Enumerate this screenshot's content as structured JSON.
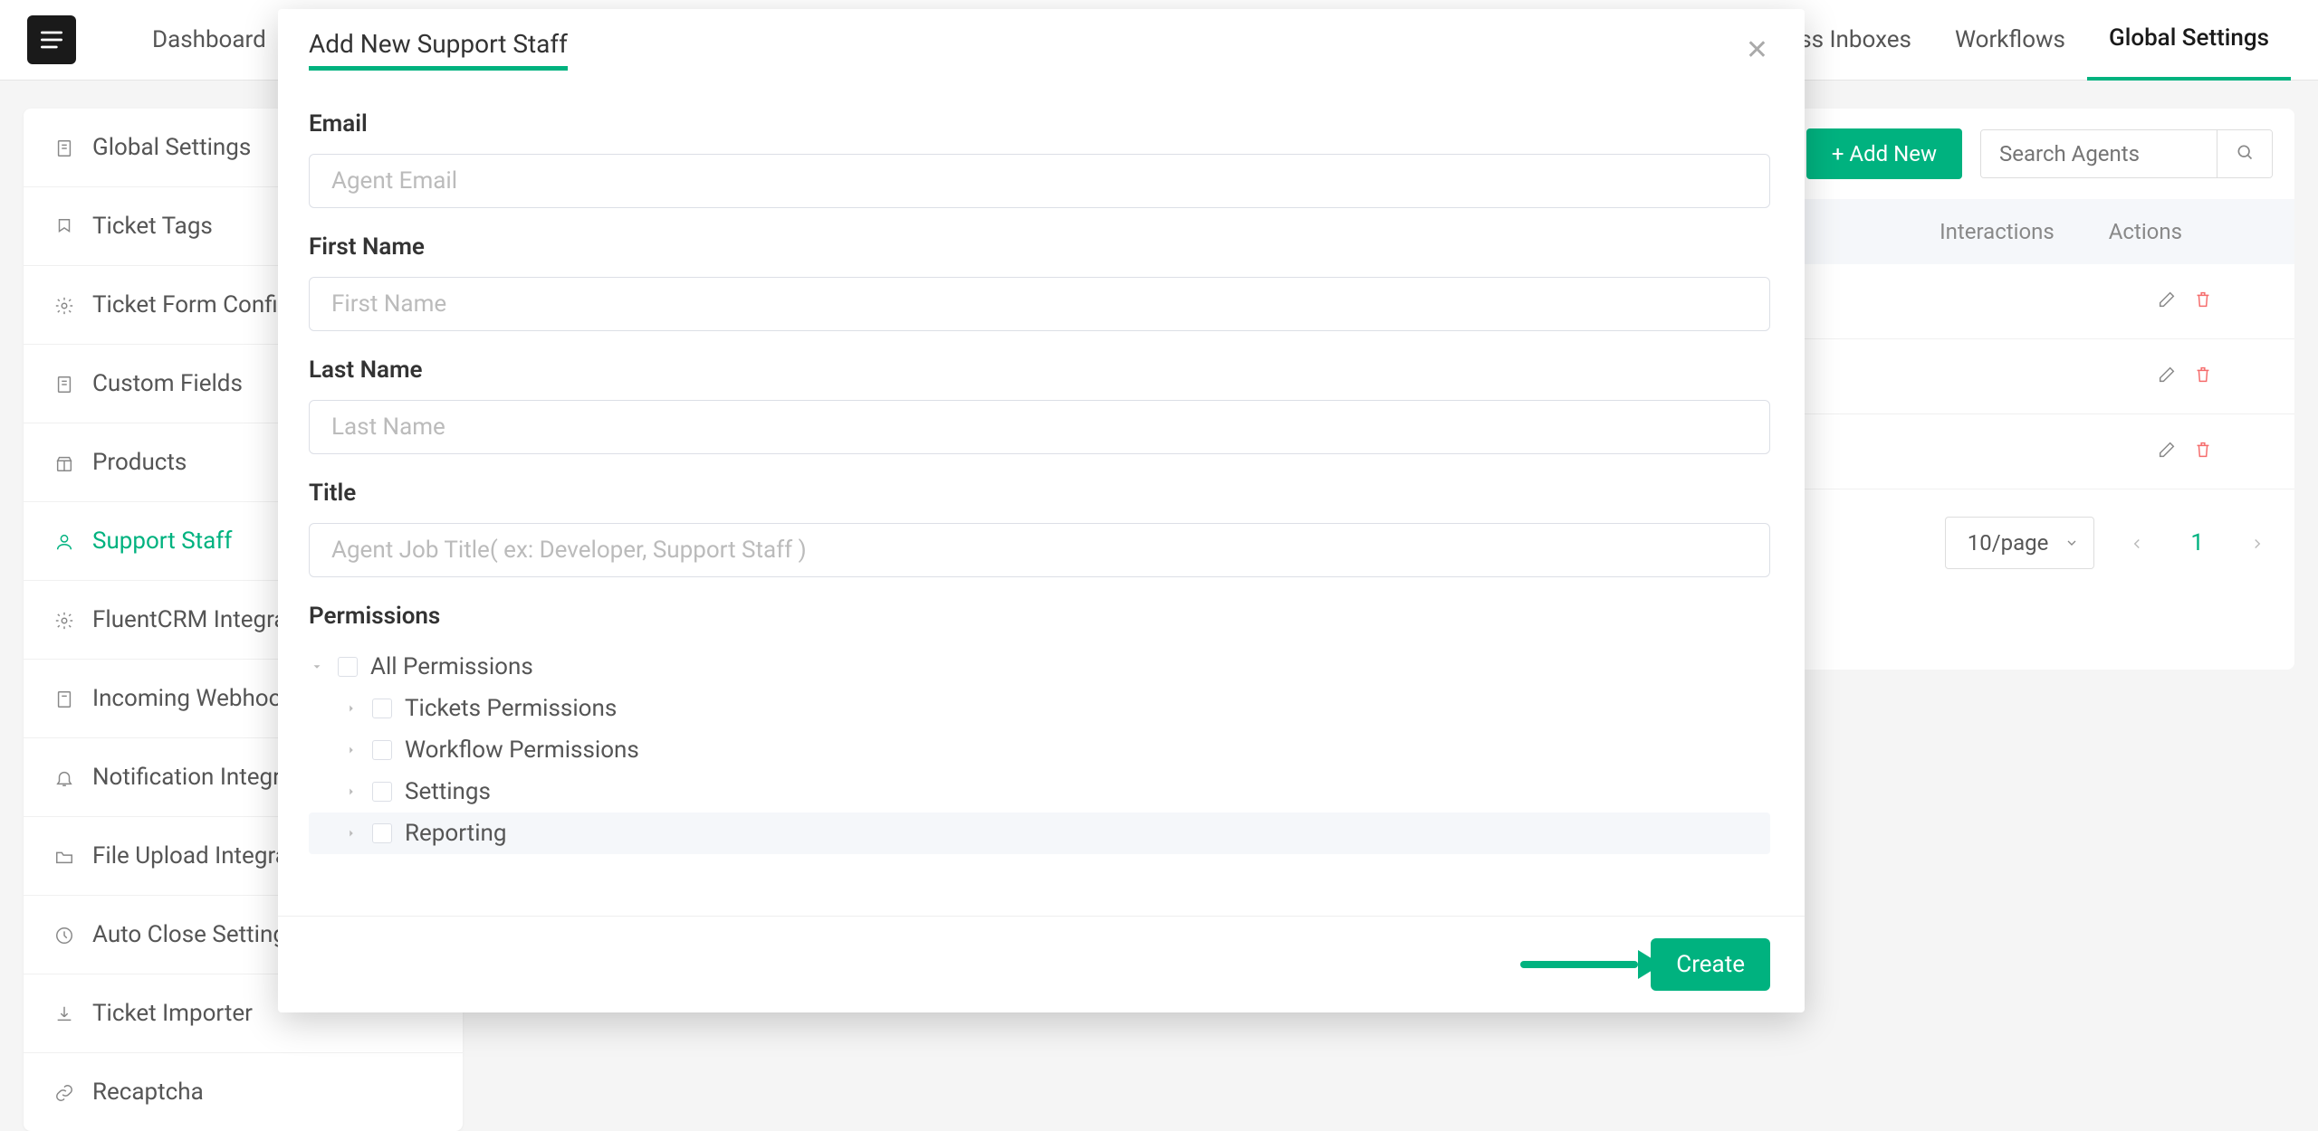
{
  "nav": {
    "dashboard": "Dashboard",
    "business_inboxes": "Business Inboxes",
    "workflows": "Workflows",
    "global_settings": "Global Settings"
  },
  "sidebar": {
    "items": [
      {
        "label": "Global Settings",
        "icon": "document-icon"
      },
      {
        "label": "Ticket Tags",
        "icon": "tag-icon"
      },
      {
        "label": "Ticket Form Config",
        "icon": "gear-icon"
      },
      {
        "label": "Custom Fields",
        "icon": "document-icon"
      },
      {
        "label": "Products",
        "icon": "gift-icon"
      },
      {
        "label": "Support Staff",
        "icon": "user-icon"
      },
      {
        "label": "FluentCRM Integration",
        "icon": "gear-icon"
      },
      {
        "label": "Incoming Webhook",
        "icon": "document-icon"
      },
      {
        "label": "Notification Integrations",
        "icon": "bell-icon"
      },
      {
        "label": "File Upload Integration",
        "icon": "folder-icon"
      },
      {
        "label": "Auto Close Settings",
        "icon": "clock-icon"
      },
      {
        "label": "Ticket Importer",
        "icon": "download-icon"
      },
      {
        "label": "Recaptcha",
        "icon": "link-icon"
      }
    ]
  },
  "toolbar": {
    "add_new_label": "+ Add New",
    "search_placeholder": "Search Agents"
  },
  "table": {
    "headers": {
      "interactions": "Interactions",
      "actions": "Actions"
    }
  },
  "pagination": {
    "page_size": "10/page",
    "current_page": "1"
  },
  "modal": {
    "title": "Add New Support Staff",
    "fields": {
      "email_label": "Email",
      "email_placeholder": "Agent Email",
      "first_name_label": "First Name",
      "first_name_placeholder": "First Name",
      "last_name_label": "Last Name",
      "last_name_placeholder": "Last Name",
      "title_label": "Title",
      "title_placeholder": "Agent Job Title( ex: Developer, Support Staff )"
    },
    "permissions_label": "Permissions",
    "permissions": {
      "root": "All Permissions",
      "children": [
        "Tickets Permissions",
        "Workflow Permissions",
        "Settings",
        "Reporting"
      ]
    },
    "create_button": "Create"
  },
  "colors": {
    "primary": "#00b27f",
    "danger": "#f56c6c"
  }
}
